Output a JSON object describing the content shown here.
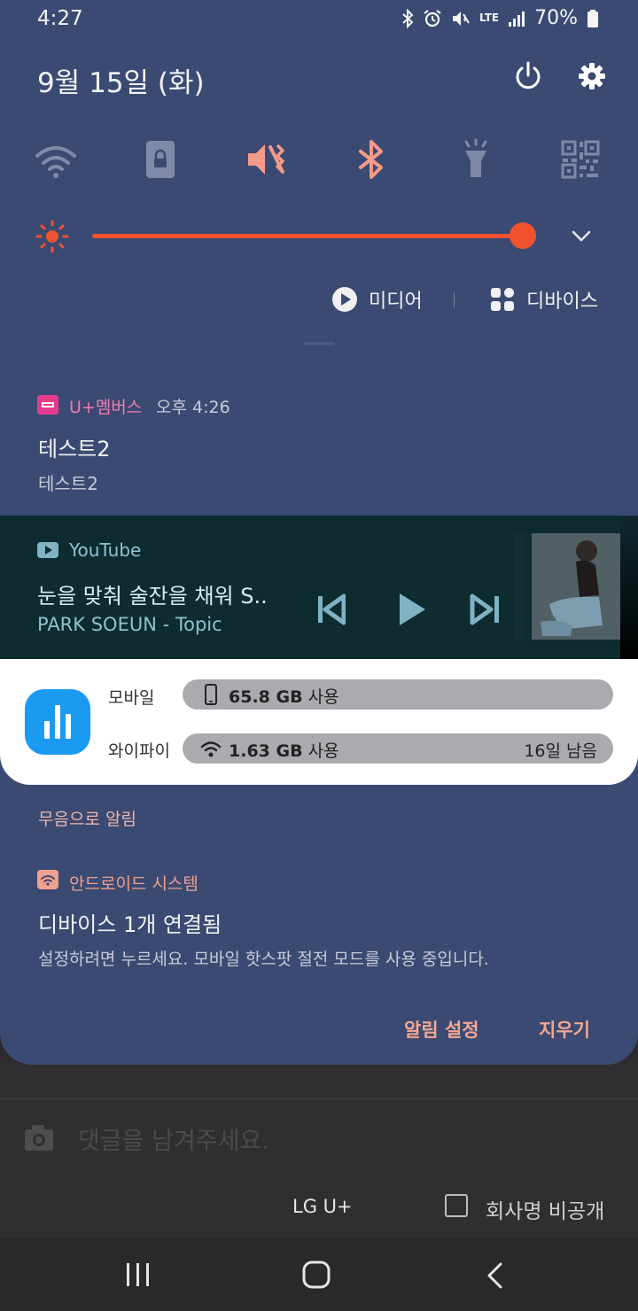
{
  "status_bar": {
    "time": "4:27",
    "battery": "70%",
    "network": "LTE"
  },
  "header": {
    "date": "9월 15일 (화)"
  },
  "quick_settings": {
    "tiles": [
      "wifi-icon",
      "lock-icon",
      "mute-vibrate-icon",
      "bluetooth-icon",
      "flashlight-icon",
      "qr-code-icon"
    ],
    "active_color": "#f59a88",
    "inactive_color": "#7f8aa8"
  },
  "brightness": {
    "level": 0.98,
    "color": "#f0522f"
  },
  "media_output": {
    "media_label": "미디어",
    "devices_label": "디바이스"
  },
  "notifications": {
    "uplus": {
      "app": "U+멤버스",
      "time": "오후 4:26",
      "title": "테스트2",
      "body": "테스트2"
    },
    "youtube": {
      "app": "YouTube",
      "title": "눈을 맞춰 술잔을 채워 S..",
      "artist": "PARK SOEUN - Topic"
    },
    "data_usage": {
      "mobile_label": "모바일",
      "mobile_value": "65.8 GB",
      "mobile_suffix": " 사용",
      "wifi_label": "와이파이",
      "wifi_value": "1.63 GB",
      "wifi_suffix": " 사용",
      "remaining": "16일 남음"
    },
    "silent_header": "무음으로 알림",
    "system": {
      "app": "안드로이드 시스템",
      "title": "디바이스 1개 연결됨",
      "body": "설정하려면 누르세요. 모바일 핫스팟 절전 모드를 사용 중입니다."
    }
  },
  "actions": {
    "notification_settings": "알림 설정",
    "clear": "지우기"
  },
  "background_app": {
    "comment_placeholder": "댓글을 남겨주세요.",
    "carrier": "LG U+",
    "hide_company_label": "회사명 비공개"
  }
}
